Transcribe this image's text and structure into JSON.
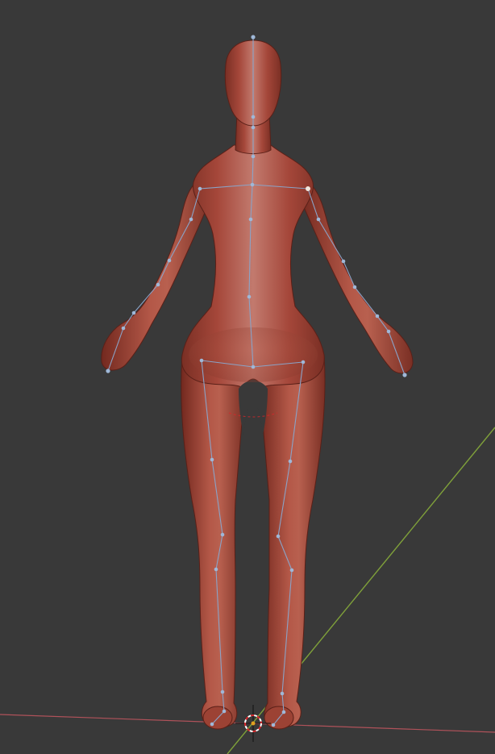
{
  "viewport": {
    "background_color": "#393939",
    "x_axis_color": "#b0525a",
    "y_axis_color": "#7fa03a"
  },
  "mesh": {
    "name": "humanoid-body-mesh",
    "base_color": "#a9483a",
    "shade_color": "#7d3226",
    "highlight_color": "#c98a7e"
  },
  "armature": {
    "bone_color": "#8aa3c7",
    "joint_color": "#9fb8d8",
    "selected_joint_color": "#f0e6dc"
  },
  "cursor": {
    "icon": "3d-cursor-icon",
    "ring_color_a": "#ffffff",
    "ring_color_b": "#d9262a"
  }
}
